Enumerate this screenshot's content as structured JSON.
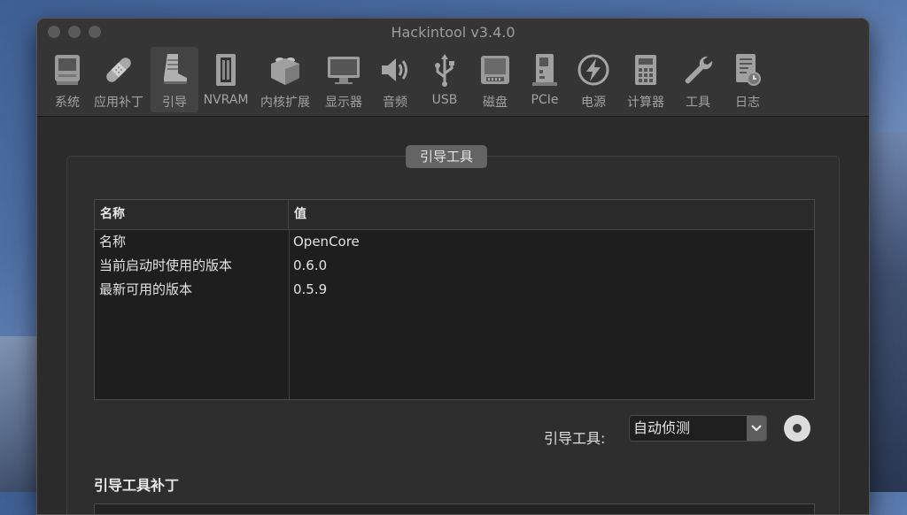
{
  "window": {
    "title": "Hackintool v3.4.0"
  },
  "toolbar": {
    "items": [
      {
        "label": "系统",
        "icon": "system-icon"
      },
      {
        "label": "应用补丁",
        "icon": "bandage-icon"
      },
      {
        "label": "引导",
        "icon": "boot-icon"
      },
      {
        "label": "NVRAM",
        "icon": "nvram-icon"
      },
      {
        "label": "内核扩展",
        "icon": "lego-icon"
      },
      {
        "label": "显示器",
        "icon": "display-icon"
      },
      {
        "label": "音频",
        "icon": "speaker-icon"
      },
      {
        "label": "USB",
        "icon": "usb-icon"
      },
      {
        "label": "磁盘",
        "icon": "disk-icon"
      },
      {
        "label": "PCIe",
        "icon": "pcie-icon"
      },
      {
        "label": "电源",
        "icon": "power-icon"
      },
      {
        "label": "计算器",
        "icon": "calculator-icon"
      },
      {
        "label": "工具",
        "icon": "wrench-icon"
      },
      {
        "label": "日志",
        "icon": "log-icon"
      }
    ],
    "active_index": 2
  },
  "bootloader": {
    "group_title": "引导工具",
    "table": {
      "headers": [
        "名称",
        "值"
      ],
      "rows": [
        [
          "名称",
          "OpenCore"
        ],
        [
          "当前启动时使用的版本",
          "0.6.0"
        ],
        [
          "最新可用的版本",
          "0.5.9"
        ]
      ]
    },
    "select_label": "引导工具:",
    "select_value": "自动侦测",
    "patches_title": "引导工具补丁"
  },
  "colors": {
    "window_bg": "#2b2b2b",
    "toolbar_bg": "#353535",
    "table_bg": "#1e1e1e"
  }
}
